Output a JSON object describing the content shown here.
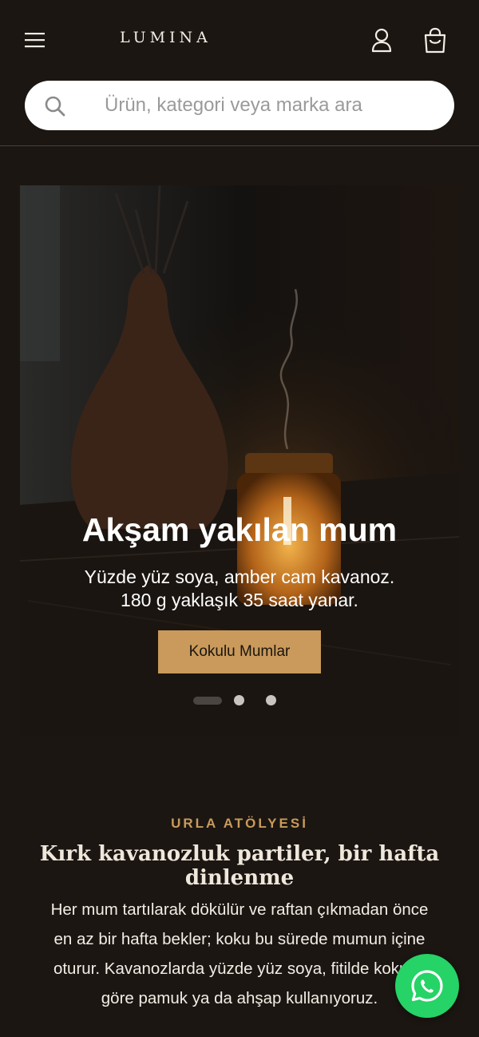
{
  "header": {
    "logo": "LUMINA",
    "menu_icon": "menu-icon",
    "account_icon": "user-icon",
    "cart_icon": "shopping-bag-icon"
  },
  "search": {
    "placeholder": "Ürün, kategori veya marka ara",
    "icon": "search-icon"
  },
  "hero": {
    "title": "Akşam yakılan mum",
    "subtitle_line1": "Yüzde yüz soya, amber cam kavanoz.",
    "subtitle_line2": "180 g yaklaşık 35 saat yanar.",
    "cta_label": "Kokulu Mumlar",
    "slides_count": 3,
    "active_slide": 1
  },
  "story": {
    "eyebrow": "URLA ATÖLYESİ",
    "title": "Kırk kavanozluk partiler, bir hafta dinlenme",
    "body_lines": [
      "Her mum tartılarak dökülür ve raftan çıkmadan önce",
      "en az bir hafta bekler; koku bu sürede mumun içine",
      "oturur. Kavanozlarda yüzde yüz soya, fitilde kokuya",
      "göre pamuk ya da ahşap kullanıyoruz."
    ]
  },
  "floating": {
    "whatsapp_icon": "whatsapp-icon"
  },
  "colors": {
    "background": "#1b1612",
    "accent": "#c99a5b",
    "whatsapp": "#25d366"
  }
}
